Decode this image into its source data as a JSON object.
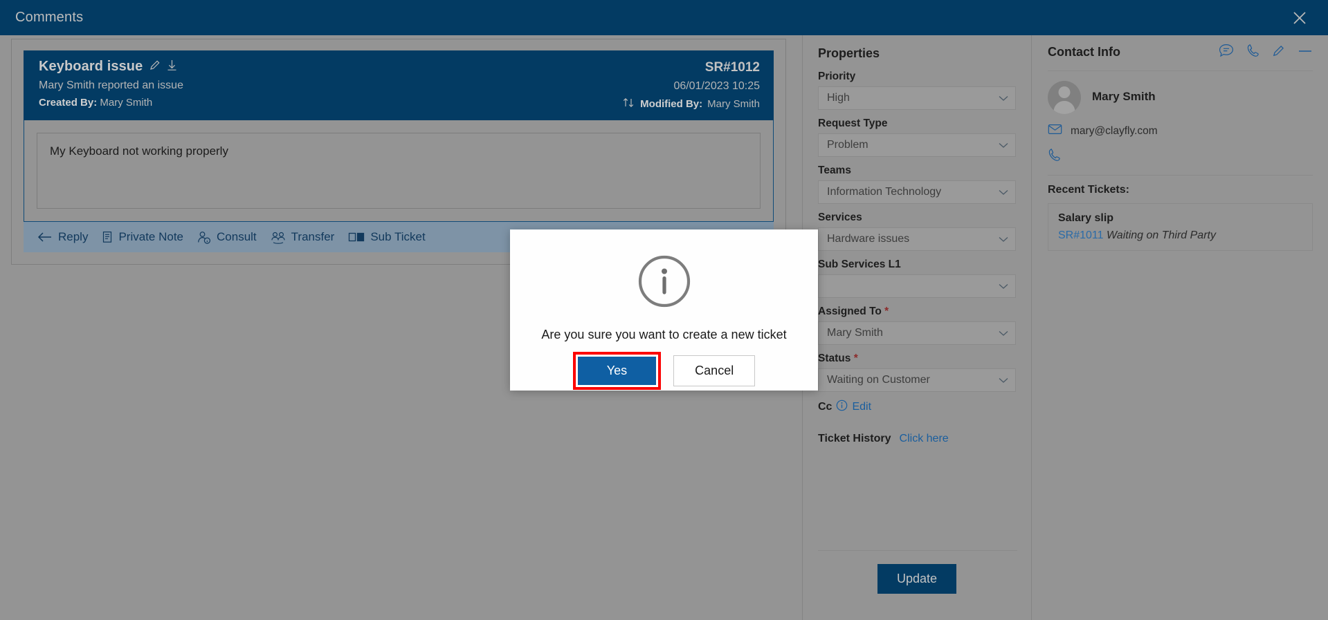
{
  "window": {
    "title": "Comments",
    "close_icon": "close-icon"
  },
  "ticket": {
    "subject": "Keyboard issue",
    "edit_icon": "pencil-icon",
    "download_icon": "download-icon",
    "reported_line": "Mary Smith reported an issue",
    "created_by_label": "Created By:",
    "created_by_value": "Mary Smith",
    "sr_number": "SR#1012",
    "datetime": "06/01/2023 10:25",
    "sort_icon": "sort-updown-icon",
    "modified_by_label": "Modified By:",
    "modified_by_value": "Mary Smith",
    "comment_body": "My Keyboard not working properly"
  },
  "actions": [
    {
      "label": "Reply",
      "icon": "arrow-left-icon"
    },
    {
      "label": "Private Note",
      "icon": "note-icon"
    },
    {
      "label": "Consult",
      "icon": "person-info-icon"
    },
    {
      "label": "Transfer",
      "icon": "transfer-people-icon"
    },
    {
      "label": "Sub Ticket",
      "icon": "panels-icon"
    }
  ],
  "properties": {
    "heading": "Properties",
    "fields": [
      {
        "label": "Priority",
        "value": "High",
        "required": false
      },
      {
        "label": "Request Type",
        "value": "Problem",
        "required": false
      },
      {
        "label": "Teams",
        "value": "Information Technology",
        "required": false
      },
      {
        "label": "Services",
        "value": "Hardware issues",
        "required": false
      },
      {
        "label": "Sub Services L1",
        "value": "",
        "required": false
      },
      {
        "label": "Assigned To",
        "value": "Mary Smith",
        "required": true
      },
      {
        "label": "Status",
        "value": "Waiting on Customer",
        "required": true
      }
    ],
    "cc_label": "Cc",
    "cc_info_icon": "info-circle-icon",
    "cc_edit_link": "Edit",
    "history_label": "Ticket History",
    "history_link": "Click here",
    "update_label": "Update"
  },
  "contact": {
    "heading": "Contact Info",
    "header_icons": [
      "chat-icon",
      "phone-icon",
      "pencil-icon",
      "minimize-icon"
    ],
    "name": "Mary Smith",
    "avatar_icon": "avatar-icon",
    "email_icon": "mail-icon",
    "email": "mary@clayfly.com",
    "phone_icon": "phone-icon",
    "phone": "",
    "recent_title": "Recent Tickets:",
    "recent_tickets": [
      {
        "title": "Salary slip",
        "id": "SR#1011",
        "status": "Waiting on Third Party"
      }
    ]
  },
  "modal": {
    "icon": "info-circle-icon",
    "message": "Are you sure you want to create a new ticket",
    "confirm_label": "Yes",
    "cancel_label": "Cancel",
    "highlight_color": "#fc0000",
    "confirm_color": "#0f5fa3"
  },
  "colors": {
    "brand_navy": "#033b63",
    "overlay_gray": "#949494",
    "link_blue": "#1a5e9e",
    "action_bar": "#7e93a6"
  }
}
